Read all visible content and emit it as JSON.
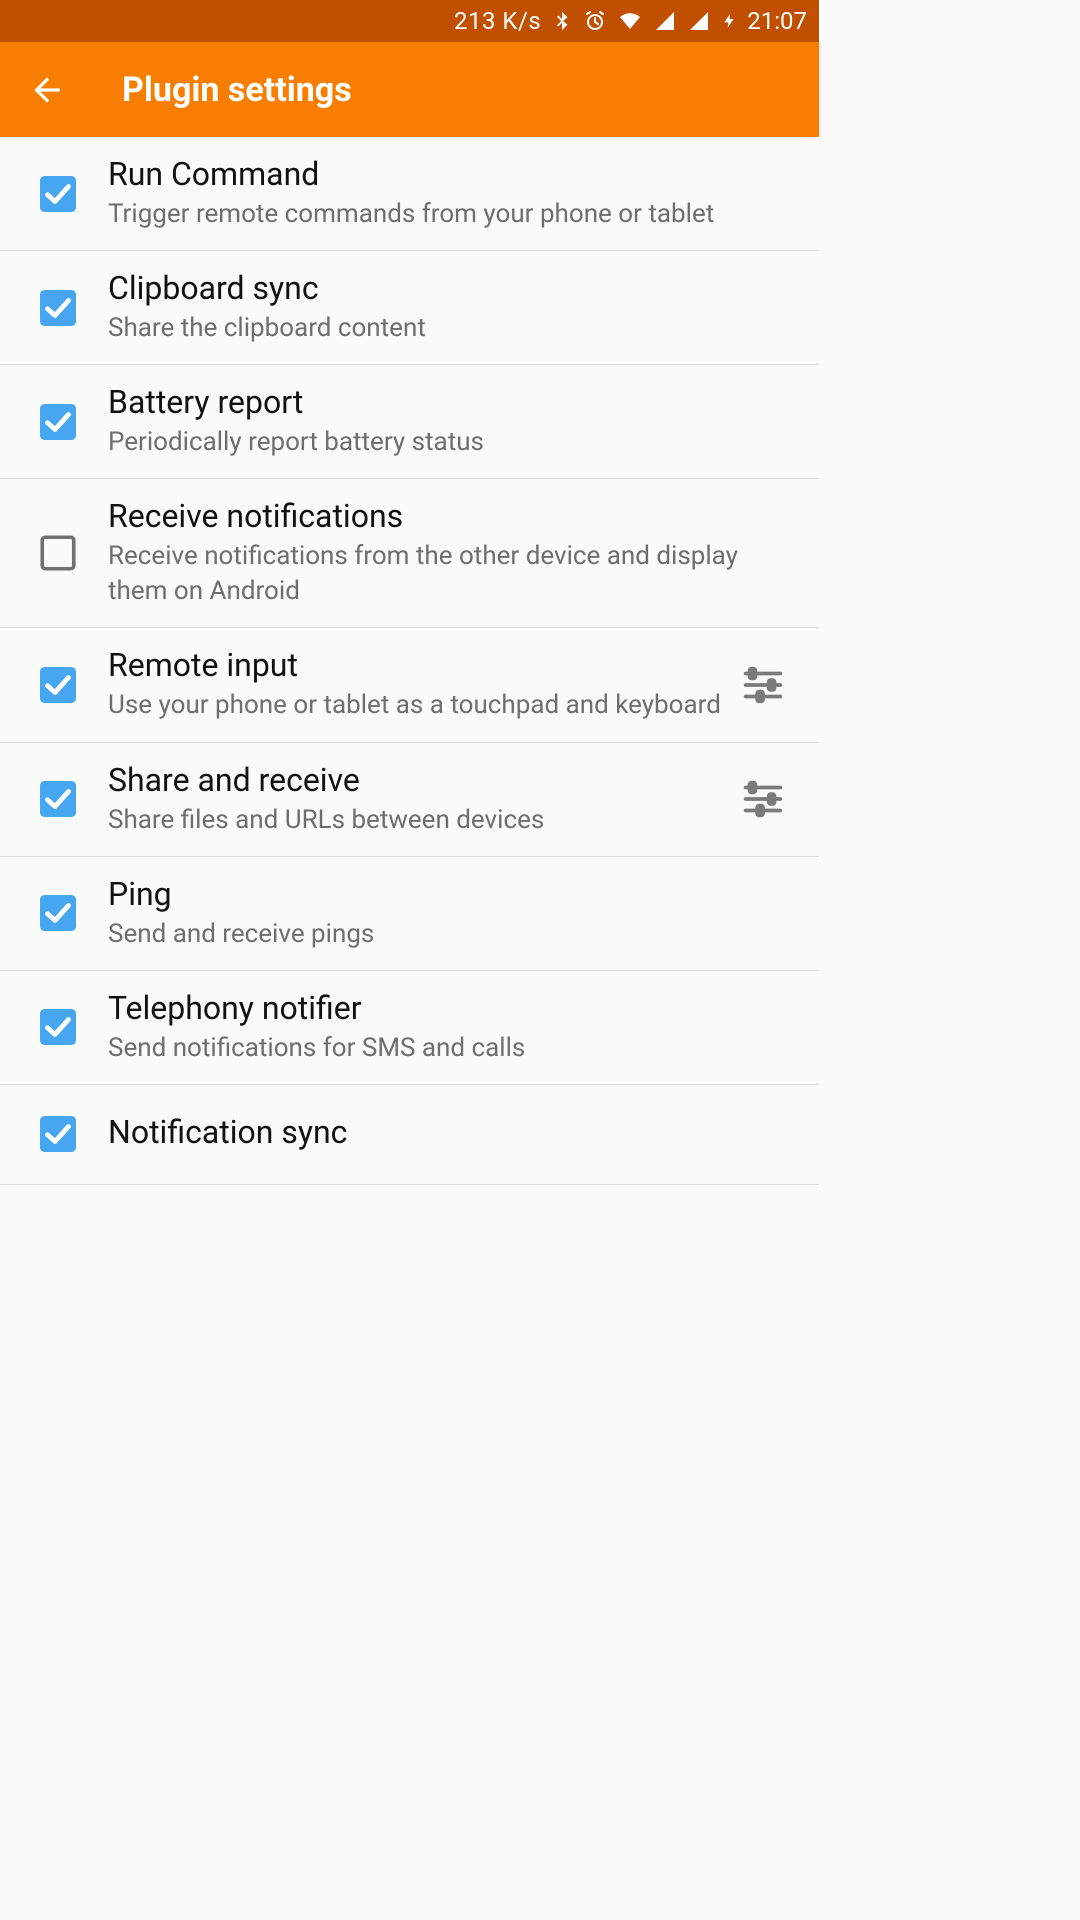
{
  "status": {
    "speed": "213 K/s",
    "time": "21:07"
  },
  "header": {
    "title": "Plugin settings"
  },
  "plugins": [
    {
      "id": "run-command",
      "title": "Run Command",
      "sub": "Trigger remote commands from your phone or tablet",
      "checked": true,
      "settings": false
    },
    {
      "id": "clipboard-sync",
      "title": "Clipboard sync",
      "sub": "Share the clipboard content",
      "checked": true,
      "settings": false
    },
    {
      "id": "battery-report",
      "title": "Battery report",
      "sub": "Periodically report battery status",
      "checked": true,
      "settings": false
    },
    {
      "id": "receive-notifications",
      "title": "Receive notifications",
      "sub": "Receive notifications from the other device and display them on Android",
      "checked": false,
      "settings": false
    },
    {
      "id": "remote-input",
      "title": "Remote input",
      "sub": "Use your phone or tablet as a touchpad and keyboard",
      "checked": true,
      "settings": true
    },
    {
      "id": "share-and-receive",
      "title": "Share and receive",
      "sub": "Share files and URLs between devices",
      "checked": true,
      "settings": true
    },
    {
      "id": "ping",
      "title": "Ping",
      "sub": "Send and receive pings",
      "checked": true,
      "settings": false
    },
    {
      "id": "telephony-notifier",
      "title": "Telephony notifier",
      "sub": "Send notifications for SMS and calls",
      "checked": true,
      "settings": false
    },
    {
      "id": "notification-sync",
      "title": "Notification sync",
      "sub": "",
      "checked": true,
      "settings": false
    }
  ]
}
